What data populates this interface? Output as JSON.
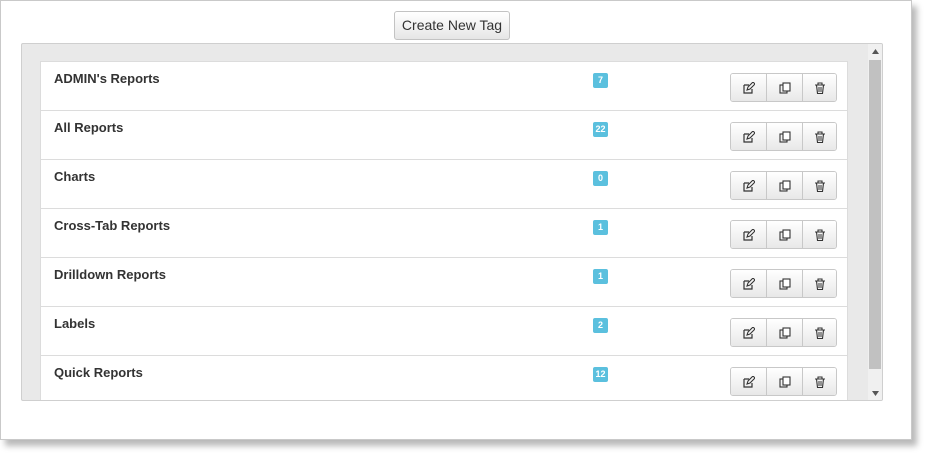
{
  "toolbar": {
    "create_label": "Create New Tag"
  },
  "tags": [
    {
      "name": "ADMIN's Reports",
      "count": "7"
    },
    {
      "name": "All Reports",
      "count": "22"
    },
    {
      "name": "Charts",
      "count": "0"
    },
    {
      "name": "Cross-Tab Reports",
      "count": "1"
    },
    {
      "name": "Drilldown Reports",
      "count": "1"
    },
    {
      "name": "Labels",
      "count": "2"
    },
    {
      "name": "Quick Reports",
      "count": "12"
    }
  ],
  "row_actions": [
    "edit-icon",
    "copy-icon",
    "trash-icon"
  ],
  "colors": {
    "badge": "#5bc0de",
    "panel": "#e9e9e9"
  }
}
